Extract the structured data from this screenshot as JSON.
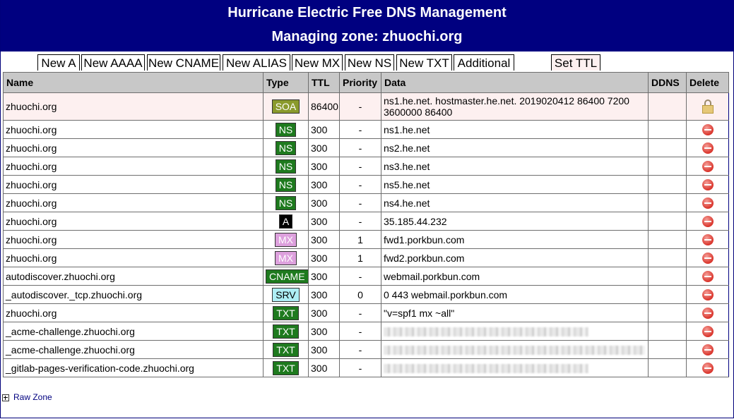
{
  "header": {
    "title": "Hurricane Electric Free DNS Management",
    "zone_line": "Managing zone: zhuochi.org"
  },
  "tabs": {
    "new_a": "New A",
    "new_aaaa": "New AAAA",
    "new_cname": "New CNAME",
    "new_alias": "New ALIAS",
    "new_mx": "New MX",
    "new_ns": "New NS",
    "new_txt": "New TXT",
    "additional": "Additional",
    "set_ttl": "Set TTL"
  },
  "table": {
    "columns": [
      "Name",
      "Type",
      "TTL",
      "Priority",
      "Data",
      "DDNS",
      "Delete"
    ],
    "rows": [
      {
        "name": "zhuochi.org",
        "type": "SOA",
        "ttl": "86400",
        "priority": "-",
        "data": "ns1.he.net. hostmaster.he.net. 2019020412 86400 7200 3600000 86400"
      },
      {
        "name": "zhuochi.org",
        "type": "NS",
        "ttl": "300",
        "priority": "-",
        "data": "ns1.he.net"
      },
      {
        "name": "zhuochi.org",
        "type": "NS",
        "ttl": "300",
        "priority": "-",
        "data": "ns2.he.net"
      },
      {
        "name": "zhuochi.org",
        "type": "NS",
        "ttl": "300",
        "priority": "-",
        "data": "ns3.he.net"
      },
      {
        "name": "zhuochi.org",
        "type": "NS",
        "ttl": "300",
        "priority": "-",
        "data": "ns5.he.net"
      },
      {
        "name": "zhuochi.org",
        "type": "NS",
        "ttl": "300",
        "priority": "-",
        "data": "ns4.he.net"
      },
      {
        "name": "zhuochi.org",
        "type": "A",
        "ttl": "300",
        "priority": "-",
        "data": "35.185.44.232"
      },
      {
        "name": "zhuochi.org",
        "type": "MX",
        "ttl": "300",
        "priority": "1",
        "data": "fwd1.porkbun.com"
      },
      {
        "name": "zhuochi.org",
        "type": "MX",
        "ttl": "300",
        "priority": "1",
        "data": "fwd2.porkbun.com"
      },
      {
        "name": "autodiscover.zhuochi.org",
        "type": "CNAME",
        "ttl": "300",
        "priority": "-",
        "data": "webmail.porkbun.com"
      },
      {
        "name": "_autodiscover._tcp.zhuochi.org",
        "type": "SRV",
        "ttl": "300",
        "priority": "0",
        "data": "0 443 webmail.porkbun.com"
      },
      {
        "name": "zhuochi.org",
        "type": "TXT",
        "ttl": "300",
        "priority": "-",
        "data": "\"v=spf1 mx ~all\""
      },
      {
        "name": "_acme-challenge.zhuochi.org",
        "type": "TXT",
        "ttl": "300",
        "priority": "-",
        "data": ""
      },
      {
        "name": "_acme-challenge.zhuochi.org",
        "type": "TXT",
        "ttl": "300",
        "priority": "-",
        "data": ""
      },
      {
        "name": "_gitlab-pages-verification-code.zhuochi.org",
        "type": "TXT",
        "ttl": "300",
        "priority": "-",
        "data": ""
      }
    ]
  },
  "footer": {
    "raw_zone": "Raw Zone"
  },
  "colors": {
    "header_bg": "#000080",
    "ns_badge": "#1e7a1e",
    "mx_badge": "#dda0dd",
    "srv_badge": "#aeeef4",
    "soa_badge": "#8a9a2c"
  }
}
